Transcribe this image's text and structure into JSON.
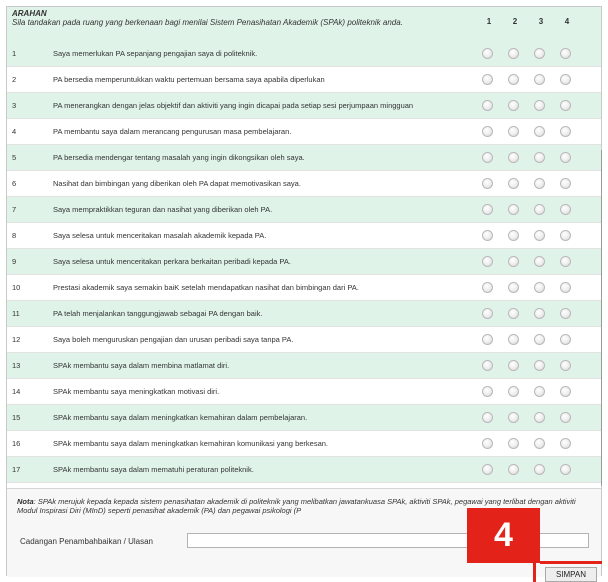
{
  "header": {
    "title": "ARAHAN",
    "instruction": "Sila tandakan pada ruang yang berkenaan bagi menilai Sistem Penasihatan Akademik (SPAk) politeknik anda.",
    "columns": [
      "1",
      "2",
      "3",
      "4"
    ]
  },
  "items": [
    {
      "no": "1",
      "text": "Saya memerlukan PA sepanjang pengajian saya di politeknik."
    },
    {
      "no": "2",
      "text": "PA bersedia memperuntukkan waktu pertemuan bersama saya apabila diperlukan"
    },
    {
      "no": "3",
      "text": "PA menerangkan dengan jelas objektif dan aktiviti yang ingin dicapai pada setiap sesi perjumpaan mingguan"
    },
    {
      "no": "4",
      "text": "PA membantu saya dalam merancang pengurusan masa pembelajaran."
    },
    {
      "no": "5",
      "text": "PA bersedia mendengar tentang masalah yang ingin dikongsikan oleh saya."
    },
    {
      "no": "6",
      "text": "Nasihat dan bimbingan yang diberikan oleh PA dapat memotivasikan saya."
    },
    {
      "no": "7",
      "text": "Saya mempraktikkan teguran dan nasihat yang diberikan oleh PA."
    },
    {
      "no": "8",
      "text": "Saya selesa untuk menceritakan masalah akademik kepada PA."
    },
    {
      "no": "9",
      "text": "Saya selesa untuk menceritakan perkara berkaitan peribadi kepada PA."
    },
    {
      "no": "10",
      "text": "Prestasi akademik saya semakin baiK setelah mendapatkan nasihat dan bimbingan dari PA."
    },
    {
      "no": "11",
      "text": "PA telah menjalankan tanggungjawab sebagai PA dengan baik."
    },
    {
      "no": "12",
      "text": "Saya boleh menguruskan pengajian dan urusan peribadi saya tanpa PA."
    },
    {
      "no": "13",
      "text": "SPAk membantu saya dalam membina matlamat diri."
    },
    {
      "no": "14",
      "text": "SPAk membantu saya meningkatkan motivasi diri."
    },
    {
      "no": "15",
      "text": "SPAk membantu saya dalam meningkatkan kemahiran dalam pembelajaran."
    },
    {
      "no": "16",
      "text": "SPAk membantu saya dalam meningkatkan kemahiran komunikasi yang berkesan."
    },
    {
      "no": "17",
      "text": "SPAk membantu saya dalam mematuhi peraturan politeknik."
    }
  ],
  "footer": {
    "nota_label": "Nota",
    "nota_text": ": SPAk merujuk kepada kepada sistem penasihatan akademik di politeknik yang melibatkan jawatankuasa SPAk, aktiviti SPAk, pegawai yang terlibat dengan aktiviti Modul Inspirasi Diri (MInD) seperti penasihat akademik (PA) dan pegawai psikologi (P",
    "ulasan_label": "Cadangan Penambahbaikan / Ulasan",
    "ulasan_value": "",
    "submit_label": "SIMPAN"
  },
  "annotation": {
    "step_number": "4",
    "color": "#e32319"
  },
  "colors": {
    "row_alt": "#dff3e9",
    "row_plain": "#ffffff"
  }
}
